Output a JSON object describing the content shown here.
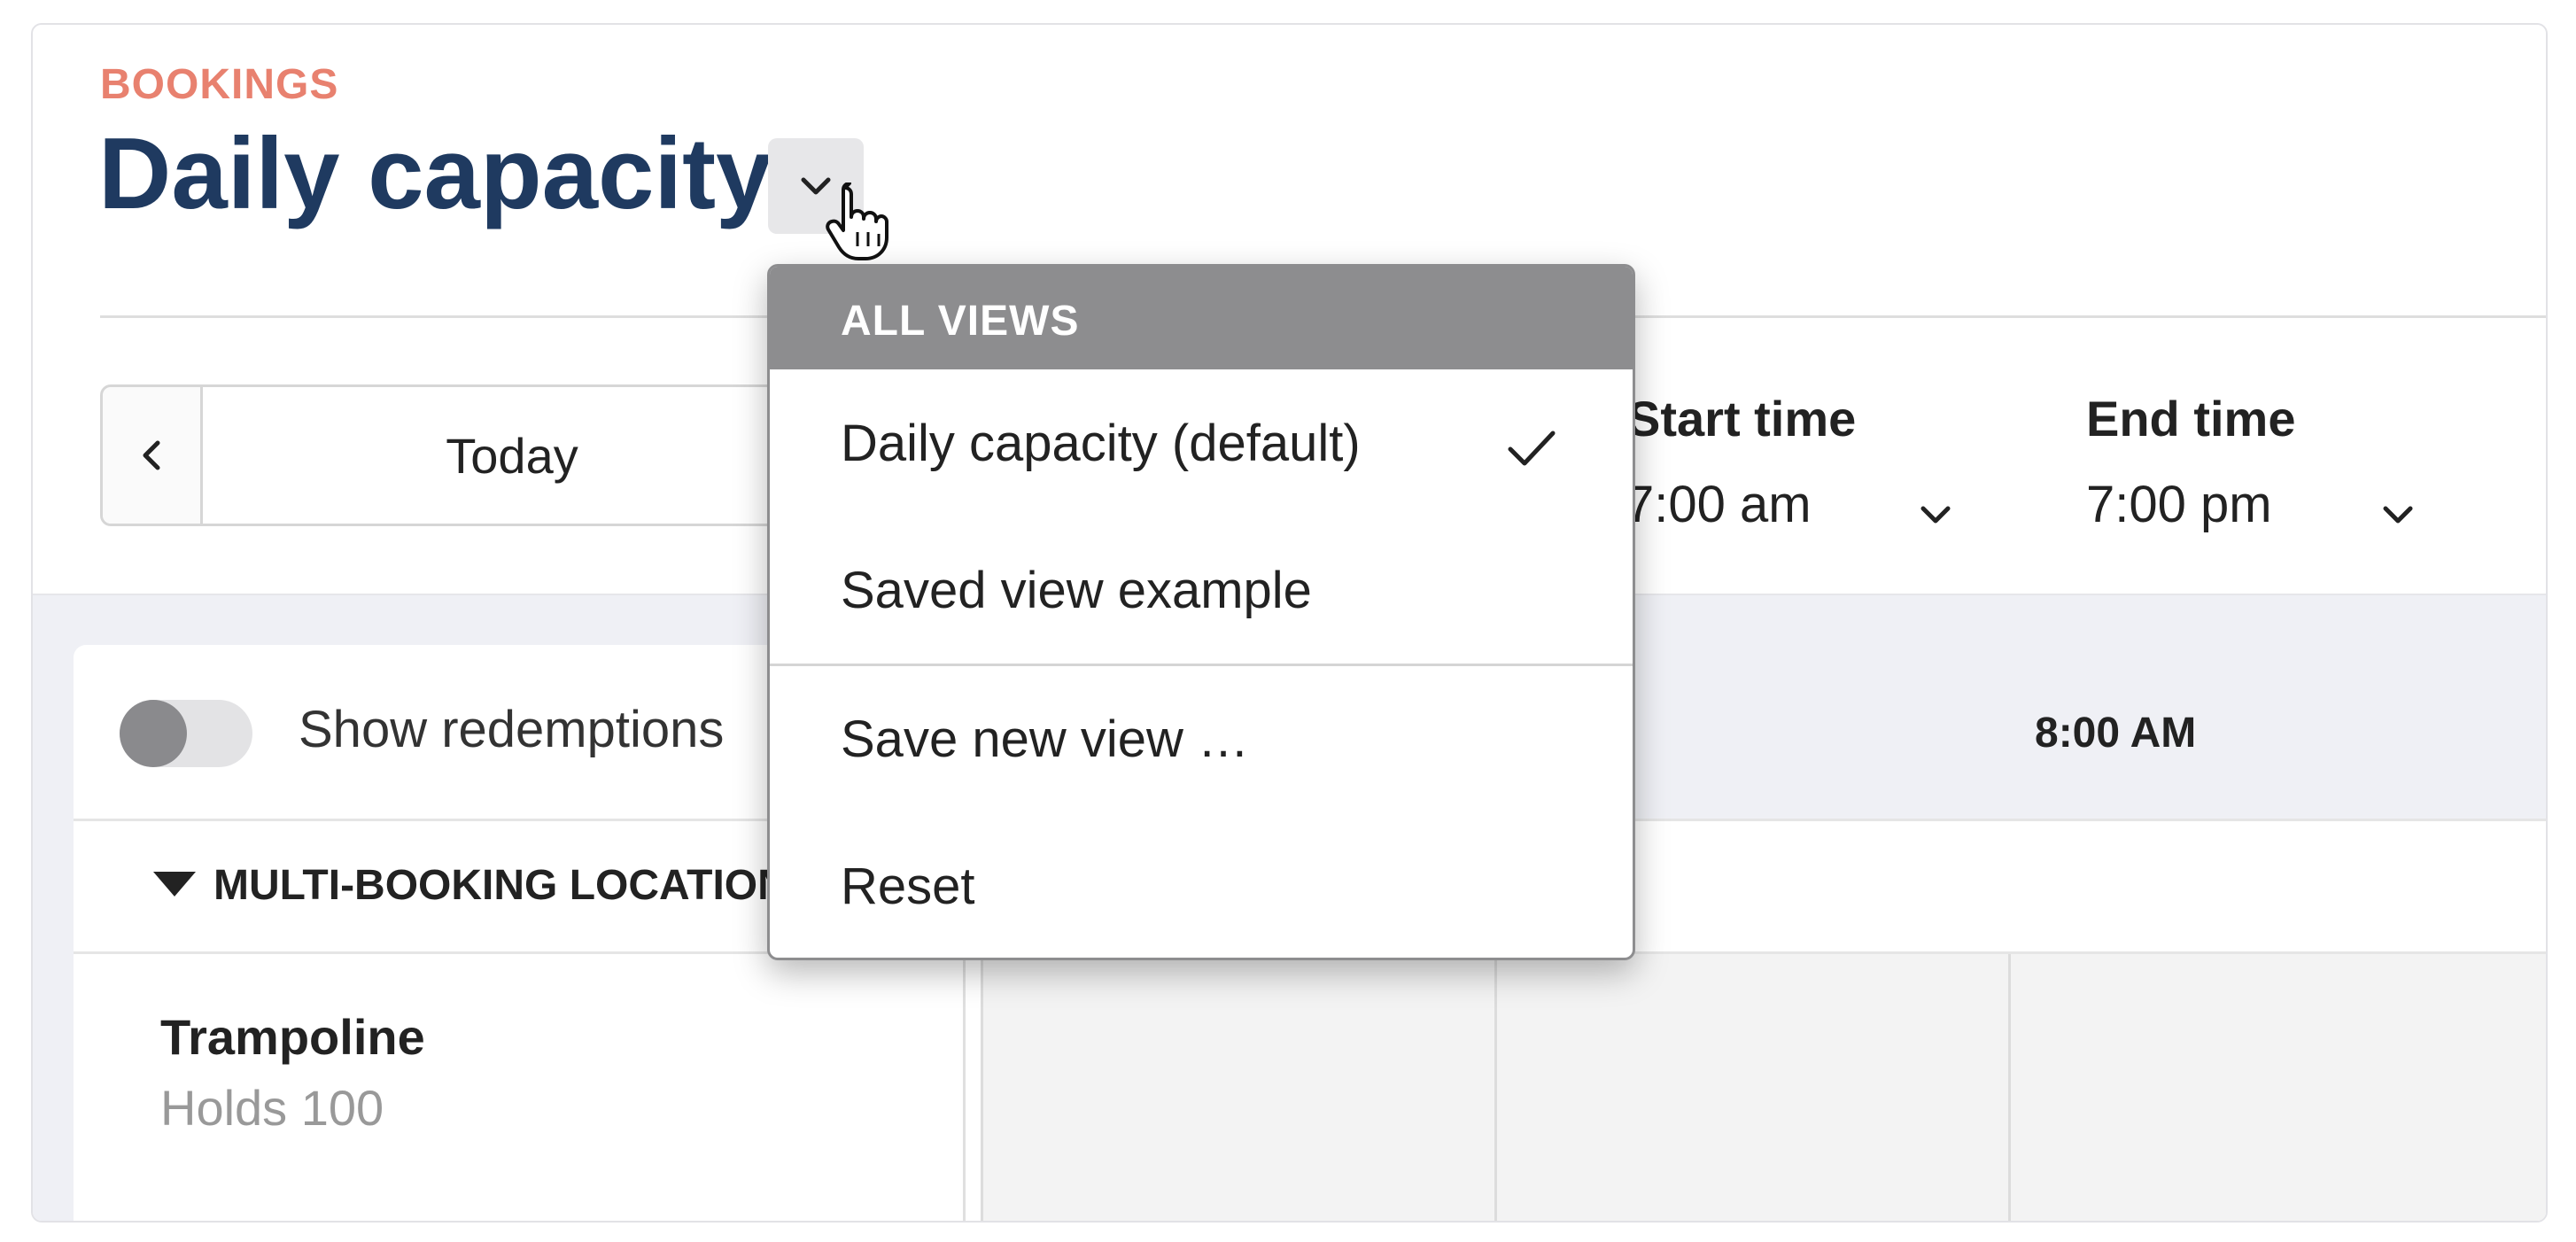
{
  "header": {
    "eyebrow": "BOOKINGS",
    "title": "Daily capacity"
  },
  "nav": {
    "today_label": "Today"
  },
  "fields": {
    "start_label": "Start time",
    "start_value": "7:00 am",
    "end_label": "End time",
    "end_value": "7:00 pm"
  },
  "panel": {
    "toggle_label": "Show redemptions",
    "toggle_on": false,
    "time_column": "8:00 AM",
    "group_label": "MULTI-BOOKING LOCATIONS",
    "resource_name": "Trampoline",
    "resource_capacity": "Holds 100"
  },
  "menu": {
    "header": "ALL VIEWS",
    "items": [
      {
        "label": "Daily capacity (default)",
        "selected": true
      },
      {
        "label": "Saved view example",
        "selected": false
      }
    ],
    "actions": [
      {
        "label": "Save new view …"
      },
      {
        "label": "Reset"
      }
    ]
  },
  "colors": {
    "accent": "#e8816f",
    "title": "#1f3a60",
    "menu_header": "#8d8d8f",
    "background": "#eff0f5"
  }
}
